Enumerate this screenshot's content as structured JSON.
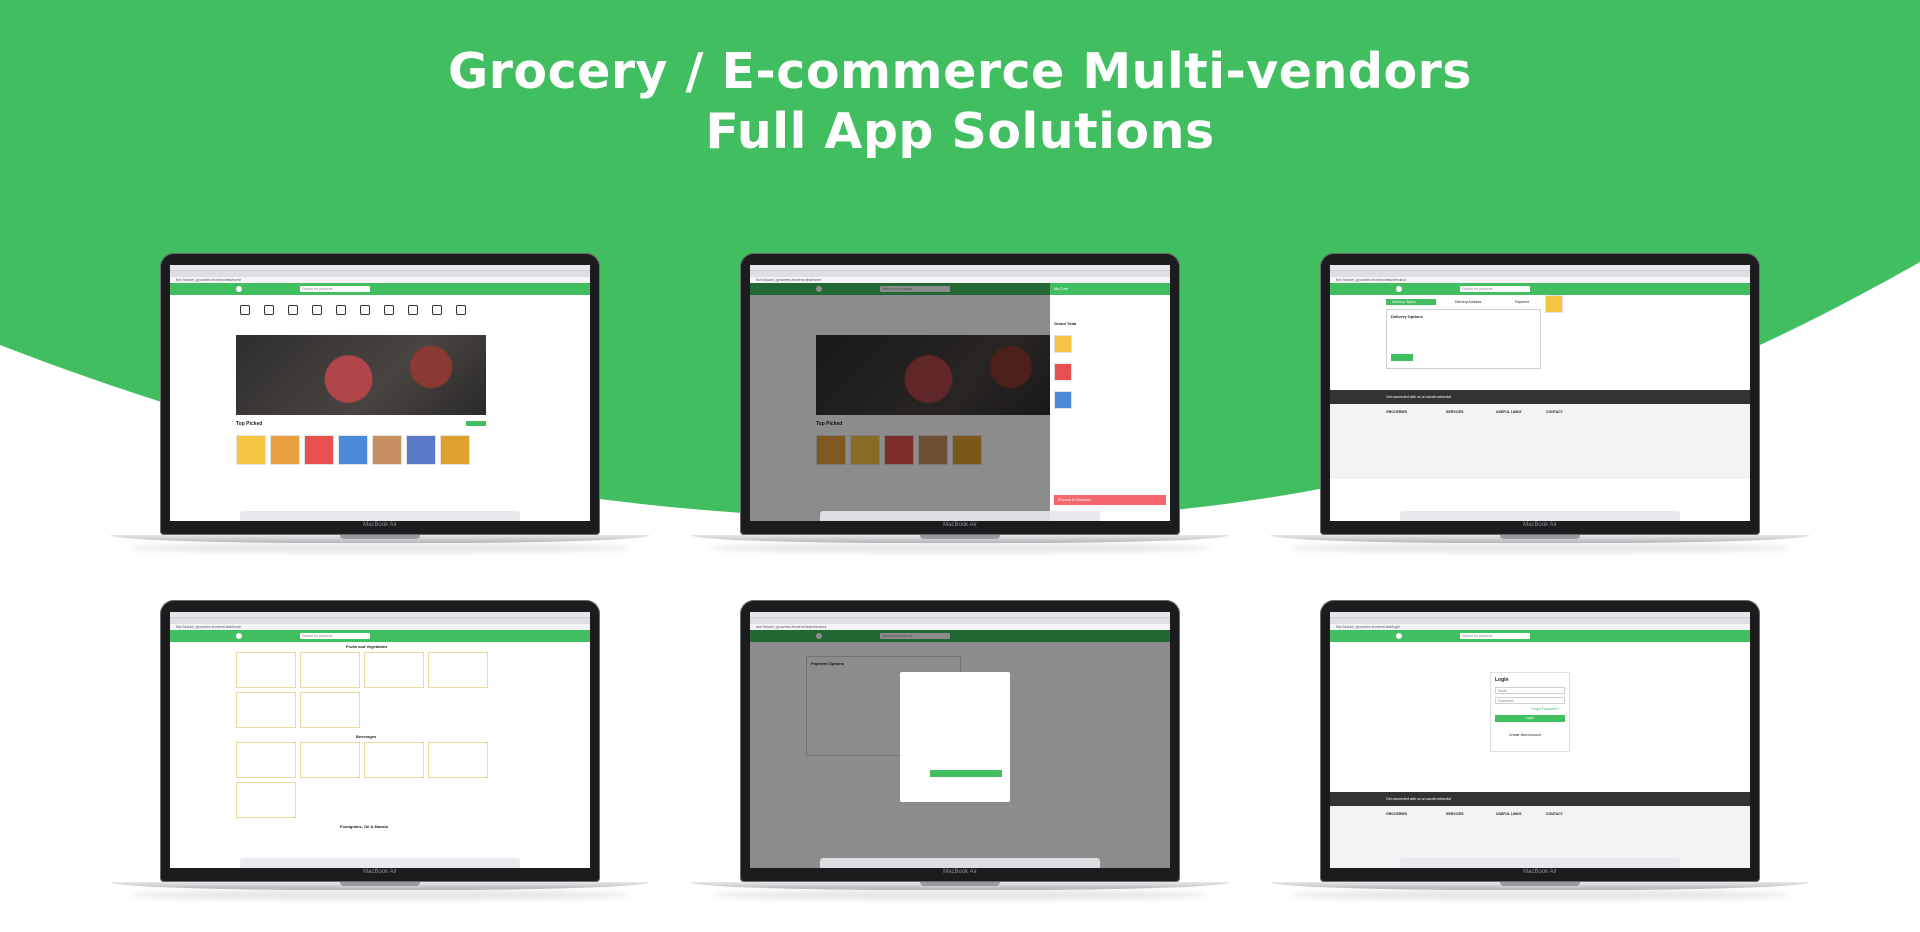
{
  "banner": {
    "title_line1": "Grocery / E-commerce Multi-vendors",
    "title_line2": "Full App Solutions",
    "background_color": "#41be5f"
  },
  "laptop_brand": "MacBook Air",
  "screens": [
    {
      "id": "home",
      "url": "Not Secure | groceries-frontend.test/home",
      "search_placeholder": "Search for products",
      "section": "Top Picked"
    },
    {
      "id": "cart",
      "url": "Not Secure | groceries-frontend.test/home",
      "search_placeholder": "Search for products",
      "section": "Top Picked",
      "panel_title": "My Cart",
      "grand_total_label": "Grand Total",
      "checkout_label": "Proceed to Checkout"
    },
    {
      "id": "checkout",
      "url": "Not Secure | groceries-frontend.test/checkout",
      "search_placeholder": "Search for products",
      "tabs": [
        "Delivery Option",
        "Delivery Address",
        "Payment"
      ],
      "panel_title": "Delivery Options",
      "footer_bar": "Get connected with us on social networks!",
      "footer_cols": [
        "GROCERIES",
        "SERVICES",
        "USEFUL LINKS",
        "CONTACT"
      ]
    },
    {
      "id": "categories",
      "url": "Not Secure | groceries-frontend.test/home",
      "search_placeholder": "Search for products",
      "sections": [
        "Fruits and Vegetables",
        "Beverages",
        "Foodgrains, Oil & Masala"
      ]
    },
    {
      "id": "payment",
      "url": "Not Secure | groceries-frontend.test/checkout",
      "search_placeholder": "Search for products",
      "panel_title": "Payment Options"
    },
    {
      "id": "login",
      "url": "Not Secure | groceries-frontend.test/login",
      "search_placeholder": "Search for products",
      "panel_title": "Login",
      "email_placeholder": "Email",
      "password_placeholder": "Password",
      "forgot_label": "Forgot Password?",
      "login_label": "Login",
      "create_label": "Create New Account",
      "footer_bar": "Get connected with us on social networks!",
      "footer_cols": [
        "GROCERIES",
        "SERVICES",
        "USEFUL LINKS",
        "CONTACT"
      ]
    }
  ]
}
